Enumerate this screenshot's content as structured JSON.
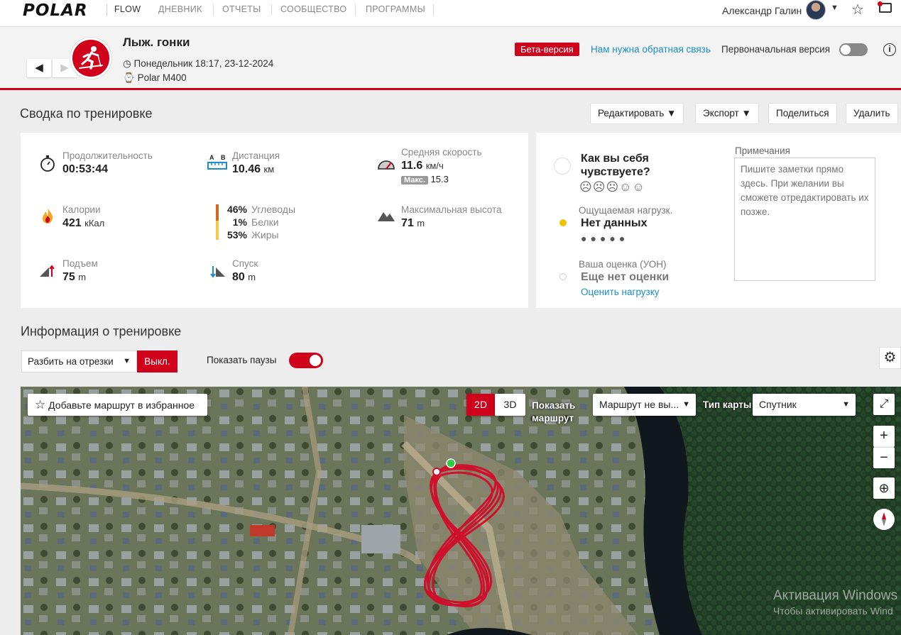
{
  "nav": {
    "logo": "POLAR",
    "items": [
      "FLOW",
      "ДНЕВНИК",
      "ОТЧЕТЫ",
      "СООБЩЕСТВО",
      "ПРОГРАММЫ"
    ],
    "user_name": "Александр Галин",
    "icons": [
      "star-icon",
      "message-icon"
    ],
    "accent": "#d0021b"
  },
  "header": {
    "prev": "◀",
    "next": "▶",
    "sport": "Лыж. гонки",
    "date": "Понедельник 18:17, 23-12-2024",
    "device": "Polar M400",
    "beta": "Бета-версия",
    "feedback": "Нам нужна обратная связь",
    "original_version": "Первоначальная версия",
    "info": "i"
  },
  "summary": {
    "title": "Сводка по тренировке",
    "buttons": {
      "edit": "Редактировать",
      "export": "Экспорт",
      "share": "Поделиться",
      "delete": "Удалить"
    },
    "duration": {
      "label": "Продолжительность",
      "value": "00:53:44"
    },
    "distance": {
      "label": "Дистанция",
      "value": "10.46",
      "unit": "км"
    },
    "avg_speed": {
      "label": "Средняя скорость",
      "value": "11.6",
      "unit": "км/ч",
      "max_label": "Макс.",
      "max_value": "15.3"
    },
    "calories": {
      "label": "Калории",
      "value": "421",
      "unit": "кКал"
    },
    "macros": [
      {
        "pct": "46%",
        "label": "Углеводы"
      },
      {
        "pct": "1%",
        "label": "Белки"
      },
      {
        "pct": "53%",
        "label": "Жиры"
      }
    ],
    "max_alt": {
      "label": "Максимальная высота",
      "value": "71",
      "unit": "m"
    },
    "ascent": {
      "label": "Подъем",
      "value": "75",
      "unit": "m"
    },
    "descent": {
      "label": "Спуск",
      "value": "80",
      "unit": "m"
    }
  },
  "feeling": {
    "question": "Как вы себя чувствуете?",
    "smileys": "☹☹☹☺☺",
    "load_label": "Ощущаемая нагрузк.",
    "load_value": "Нет данных",
    "load_dots": "●●●●●",
    "rpe_label": "Ваша оценка (УОН)",
    "rpe_value": "Еще нет оценки",
    "rpe_link": "Оценить нагрузку",
    "notes_label": "Примечания",
    "notes_placeholder": "Пишите заметки прямо здесь. При желании вы сможете отредактировать их позже."
  },
  "training_info": {
    "title": "Информация о тренировке",
    "segments": "Разбить на отрезки",
    "off": "Выкл.",
    "show_pauses": "Показать паузы",
    "show_pauses_on": true
  },
  "map": {
    "favorite": "Добавьте маршрут в избранное",
    "mode_2d": "2D",
    "mode_3d": "3D",
    "show_route": "Показать маршрут",
    "route_select": "Маршрут не вы...",
    "map_type_label": "Тип карты",
    "map_type": "Спутник",
    "zoom_in": "+",
    "zoom_out": "−",
    "watermark_1": "Активация Windows",
    "watermark_2": "Чтобы активировать Wind"
  }
}
